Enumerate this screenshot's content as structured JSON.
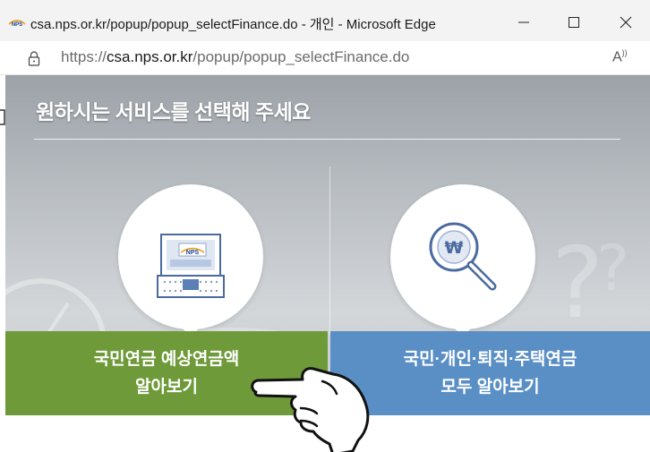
{
  "window": {
    "title": "csa.nps.or.kr/popup/popup_selectFinance.do - 개인 - Microsoft Edge",
    "favicon": "nps-logo-icon",
    "controls": [
      "minimize-icon",
      "maximize-icon",
      "close-icon"
    ]
  },
  "address": {
    "scheme": "https://",
    "host": "csa.nps.or.kr",
    "path": "/popup/popup_selectFinance.do",
    "icons": [
      "lock-icon",
      "read-aloud-icon"
    ]
  },
  "popup": {
    "heading": "원하시는 서비스를 선택해 주세요",
    "options": [
      {
        "icon": "laptop-nps-icon",
        "line1": "국민연금 예상연금액",
        "line2": "알아보기",
        "color": "#6f9a3a"
      },
      {
        "icon": "won-magnifier-icon",
        "line1": "국민·개인·퇴직·주택연금",
        "line2": "모두 알아보기",
        "color": "#5a8fc6"
      }
    ],
    "laptop_screen_text": "NPS"
  },
  "overlay": {
    "icon": "pointing-hand-icon"
  }
}
